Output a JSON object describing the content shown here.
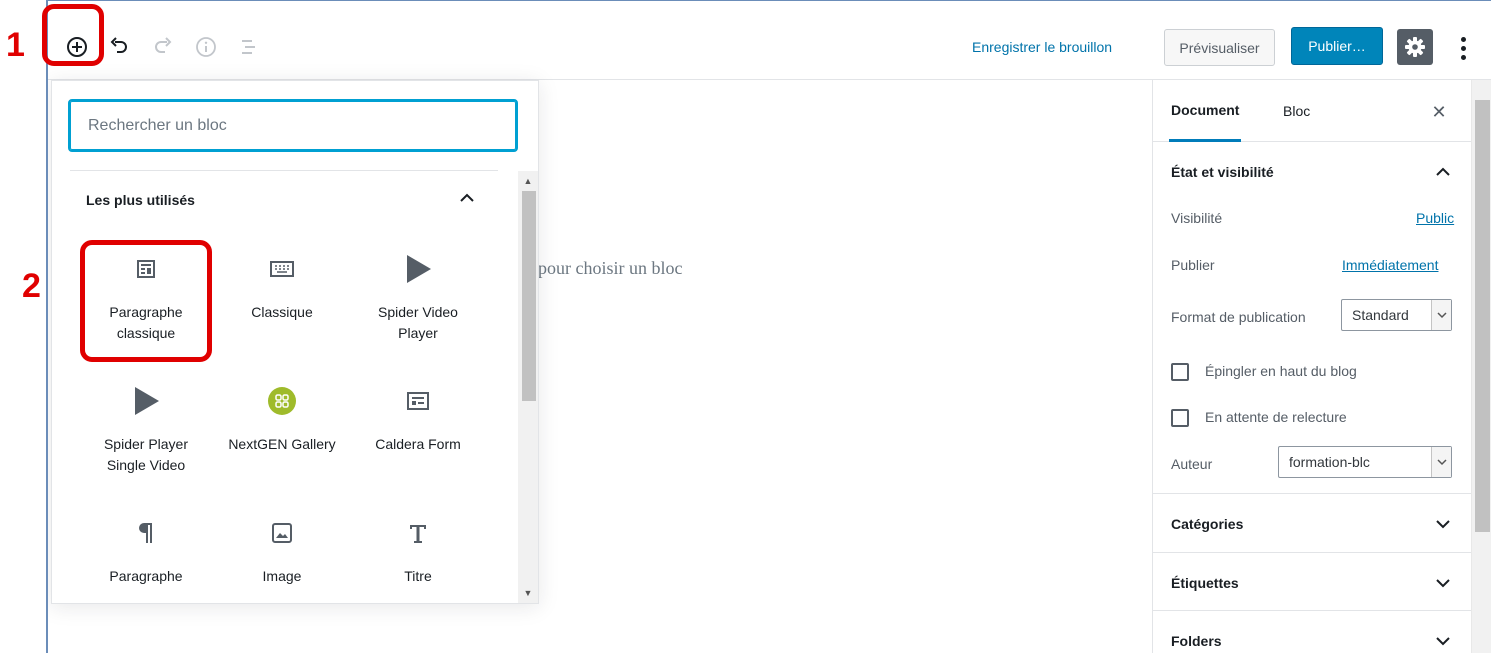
{
  "annotations": {
    "step1": "1",
    "step2": "2"
  },
  "toolbar": {
    "add_block": "add-block-icon",
    "undo": "undo-icon",
    "redo": "redo-icon",
    "info": "info-icon",
    "outline": "outline-icon",
    "save_draft": "Enregistrer le brouillon",
    "preview": "Prévisualiser",
    "publish": "Publier…",
    "settings": "gear-icon",
    "more": "more-vertical-icon"
  },
  "editor": {
    "hint": "pour choisir un bloc"
  },
  "inserter": {
    "search_placeholder": "Rechercher un bloc",
    "panel_title": "Les plus utilisés",
    "blocks": [
      {
        "label": "Paragraphe classique",
        "icon": "classic-paragraph-icon"
      },
      {
        "label": "Classique",
        "icon": "keyboard-icon"
      },
      {
        "label": "Spider Video Player",
        "icon": "play-icon"
      },
      {
        "label": "Spider Player Single Video",
        "icon": "play-icon"
      },
      {
        "label": "NextGEN Gallery",
        "icon": "nextgen-gallery-icon"
      },
      {
        "label": "Caldera Form",
        "icon": "form-icon"
      },
      {
        "label": "Paragraphe",
        "icon": "pilcrow-icon"
      },
      {
        "label": "Image",
        "icon": "image-icon"
      },
      {
        "label": "Titre",
        "icon": "heading-icon"
      }
    ]
  },
  "sidebar": {
    "tabs": [
      "Document",
      "Bloc"
    ],
    "status": {
      "title": "État et visibilité",
      "visibility_label": "Visibilité",
      "visibility_value": "Public",
      "publish_label": "Publier",
      "publish_value": "Immédiatement",
      "format_label": "Format de publication",
      "format_value": "Standard",
      "sticky_label": "Épingler en haut du blog",
      "pending_label": "En attente de relecture",
      "author_label": "Auteur",
      "author_value": "formation-blc"
    },
    "categories": "Catégories",
    "tags": "Étiquettes",
    "folders": "Folders"
  },
  "colors": {
    "accent": "#0085ba",
    "link": "#0073aa",
    "annotation": "#e00000",
    "focus": "#00a0d2"
  }
}
